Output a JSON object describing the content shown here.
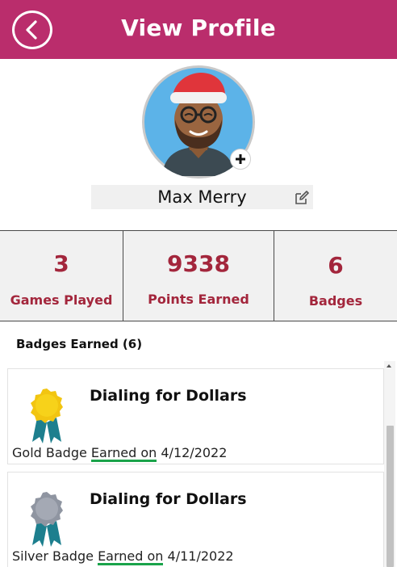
{
  "header": {
    "title": "View Profile",
    "back_icon": "chevron-left-icon",
    "background_color": "#ba2d6c"
  },
  "profile": {
    "avatar_icon": "santa-hat-avatar",
    "add_photo_icon": "plus-icon",
    "name": "Max Merry",
    "edit_icon": "edit-icon"
  },
  "stats": [
    {
      "value": "3",
      "label": "Games Played"
    },
    {
      "value": "9338",
      "label": "Points Earned"
    },
    {
      "value": "6",
      "label": "Badges"
    }
  ],
  "badges_section": {
    "title": "Badges Earned (6)"
  },
  "badges": [
    {
      "name": "Dialing for Dollars",
      "type": "Gold Badge",
      "earned_label": "Earned on",
      "date": "4/12/2022",
      "medal_color": "#f7d21a"
    },
    {
      "name": "Dialing for Dollars",
      "type": "Silver Badge",
      "earned_label": "Earned on",
      "date": "4/11/2022",
      "medal_color": "#a4a9b4"
    }
  ],
  "colors": {
    "accent": "#ba2d6c",
    "stat_text": "#a3263c",
    "underline": "#1aa34a"
  }
}
